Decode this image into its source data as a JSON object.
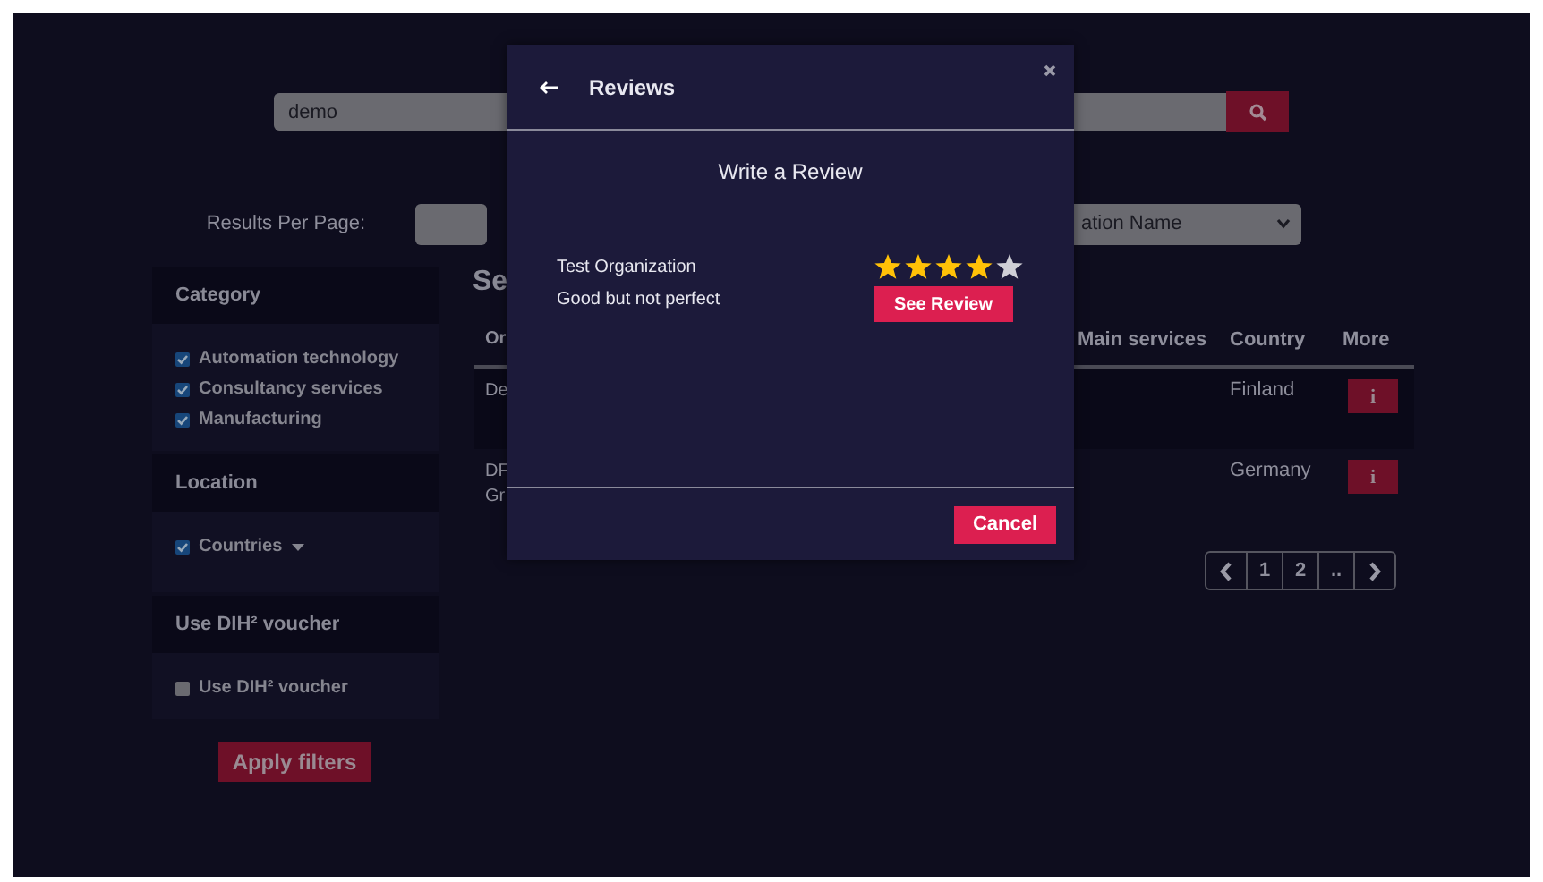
{
  "search": {
    "value": "demo"
  },
  "results_per_page": {
    "label": "Results Per Page:"
  },
  "sort_select": {
    "value": "ation Name"
  },
  "sidebar": {
    "sections": [
      {
        "title": "Category",
        "items": [
          {
            "kind": "checkbox",
            "label": "Automation technology",
            "checked": true
          },
          {
            "kind": "checkbox",
            "label": "Consultancy services",
            "checked": true
          },
          {
            "kind": "checkbox",
            "label": "Manufacturing",
            "checked": true
          }
        ]
      },
      {
        "title": "Location",
        "items": [
          {
            "kind": "dropdown",
            "label": "Countries",
            "checked": true
          }
        ]
      },
      {
        "title": "Use DIH² voucher",
        "items": [
          {
            "kind": "checkbox",
            "label": "Use DIH² voucher",
            "checked": false
          }
        ]
      }
    ]
  },
  "apply_button": "Apply filters",
  "results": {
    "heading": "Se",
    "columns": [
      "Or",
      "Main services",
      "Country",
      "More"
    ],
    "rows": [
      {
        "name_lines": [
          "De"
        ],
        "country": "Finland",
        "more": "i"
      },
      {
        "name_lines": [
          "DF",
          "Gr"
        ],
        "country": "Germany",
        "more": "i"
      }
    ]
  },
  "pagination": {
    "pages": [
      "1",
      "2",
      ".."
    ]
  },
  "modal": {
    "title": "Reviews",
    "heading": "Write a Review",
    "reviews": [
      {
        "organization": "Test Organization",
        "comment": "Good but not perfect",
        "stars": 4,
        "button": "See Review"
      }
    ],
    "cancel": "Cancel"
  }
}
